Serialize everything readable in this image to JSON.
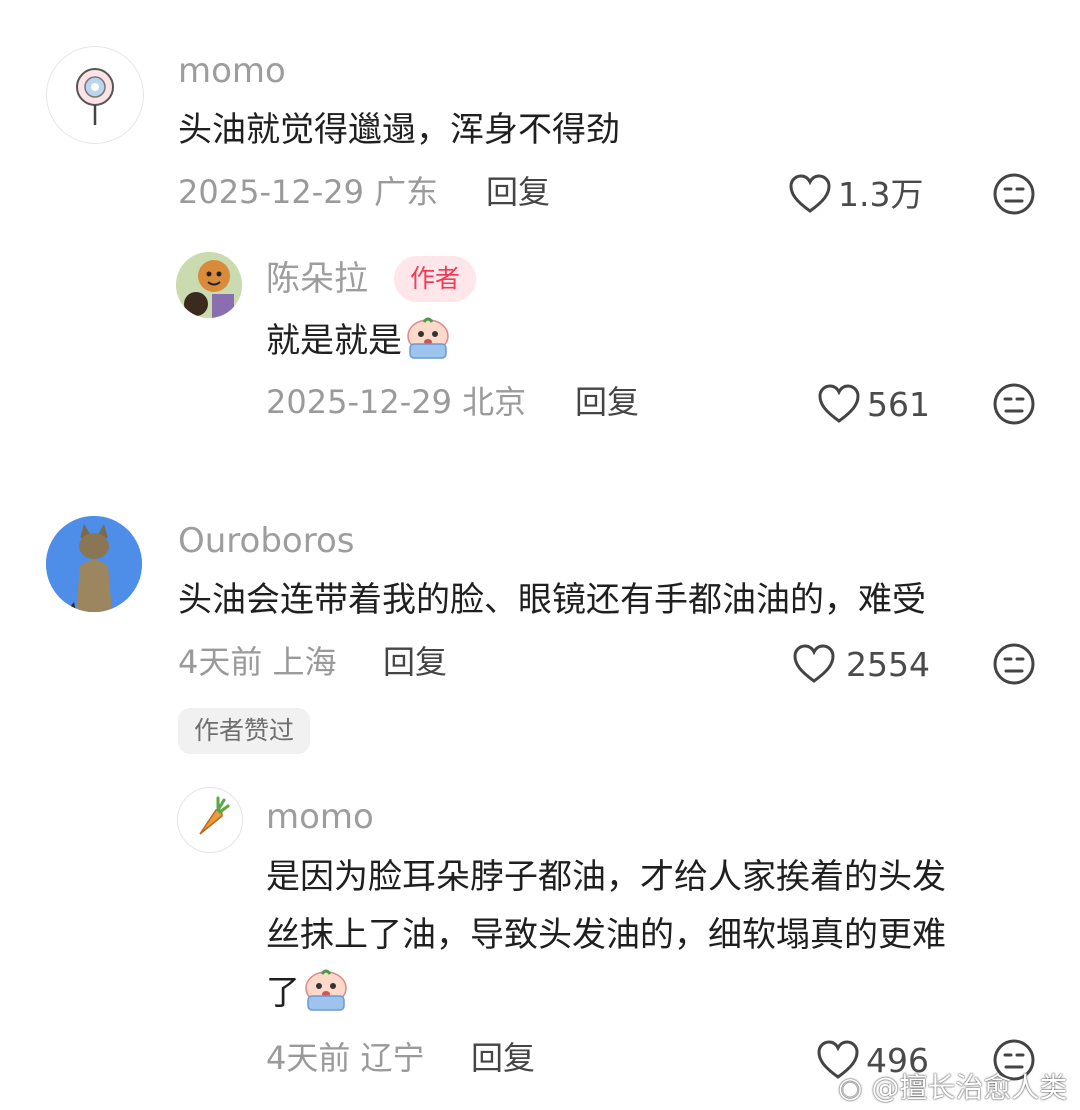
{
  "comments": [
    {
      "user": "momo",
      "text": "头油就觉得邋遢，浑身不得劲",
      "date": "2025-12-29",
      "location": "广东",
      "reply_label": "回复",
      "likes": "1.3万",
      "avatar_icon": "lollipop-icon"
    },
    {
      "user": "陈朵拉",
      "badge": "作者",
      "text": "就是就是",
      "emoji": "crying-bun-emoji",
      "date": "2025-12-29",
      "location": "北京",
      "reply_label": "回复",
      "likes": "561",
      "avatar_icon": "cartoon-kid-avatar"
    },
    {
      "user": "Ouroboros",
      "text": "头油会连带着我的脸、眼镜还有手都油油的，难受",
      "date": "4天前",
      "location": "上海",
      "reply_label": "回复",
      "likes": "2554",
      "author_liked": "作者赞过",
      "avatar_icon": "cat-avatar"
    },
    {
      "user": "momo",
      "text_lines": [
        "是因为脸耳朵脖子都油，才给人家挨着的头发",
        "丝抹上了油，导致头发油的，细软塌真的更难",
        "了"
      ],
      "emoji": "crying-bun-emoji",
      "date": "4天前",
      "location": "辽宁",
      "reply_label": "回复",
      "likes": "496",
      "avatar_icon": "carrot-icon"
    }
  ],
  "watermark": "@擅长治愈人类",
  "colors": {
    "badge_bg": "#ffe6eb",
    "badge_text": "#f23a56",
    "meta": "#9a9a9a"
  }
}
